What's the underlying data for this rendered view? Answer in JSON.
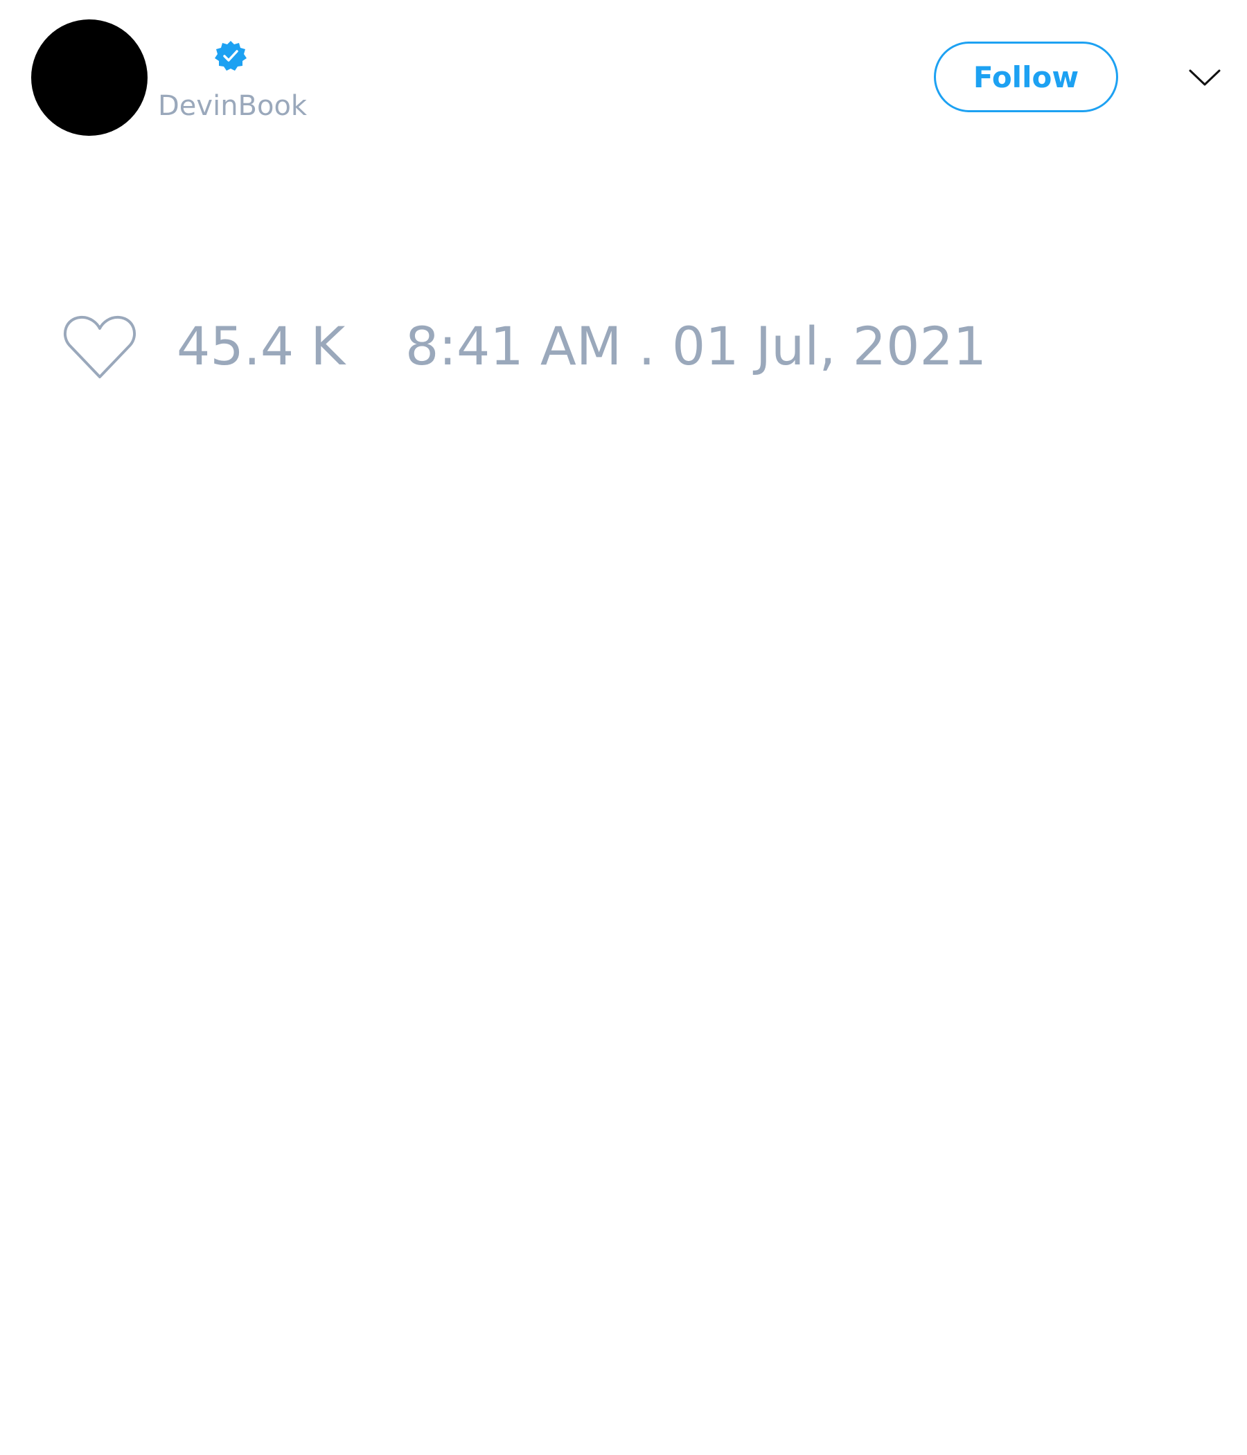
{
  "tweet": {
    "author": {
      "username": "DevinBook",
      "avatar_color": "#000000",
      "verified": true,
      "verified_icon": "verified-badge-icon",
      "verified_color": "#1da1f2"
    },
    "follow_button": {
      "label": "Follow",
      "accent": "#1da1f2"
    },
    "menu_icon": "chevron-down-icon",
    "likes": {
      "icon": "heart-icon",
      "count": "45.4 K"
    },
    "timestamp": "8:41 AM . 01 Jul, 2021",
    "muted_text_color": "#9aa8bb"
  }
}
